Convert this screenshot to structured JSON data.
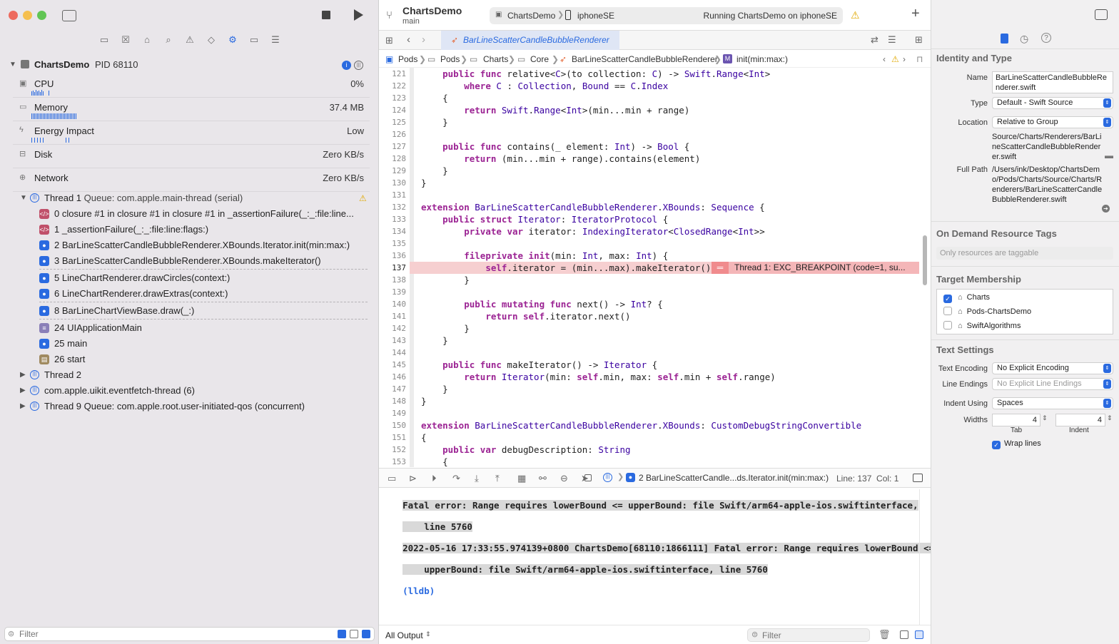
{
  "toolbar": {
    "project": "ChartsDemo",
    "branch": "main",
    "scheme": "ChartsDemo",
    "device": "iphoneSE",
    "status": "Running ChartsDemo on iphoneSE"
  },
  "debug_nav": {
    "process_name": "ChartsDemo",
    "process_pid": "PID 68110",
    "gauges": [
      {
        "label": "CPU",
        "value": "0%"
      },
      {
        "label": "Memory",
        "value": "37.4 MB"
      },
      {
        "label": "Energy Impact",
        "value": "Low"
      },
      {
        "label": "Disk",
        "value": "Zero KB/s"
      },
      {
        "label": "Network",
        "value": "Zero KB/s"
      }
    ],
    "thread1": {
      "name": "Thread 1",
      "queue": "Queue: com.apple.main-thread (serial)"
    },
    "frames": [
      "0 closure #1 in closure #1 in closure #1 in _assertionFailure(_:_:file:line...",
      "1 _assertionFailure(_:_:file:line:flags:)",
      "2 BarLineScatterCandleBubbleRenderer.XBounds.Iterator.init(min:max:)",
      "3 BarLineScatterCandleBubbleRenderer.XBounds.makeIterator()",
      "5 LineChartRenderer.drawCircles(context:)",
      "6 LineChartRenderer.drawExtras(context:)",
      "8 BarLineChartViewBase.draw(_:)",
      "24 UIApplicationMain",
      "25 main",
      "26 start"
    ],
    "other_threads": [
      "Thread 2",
      "com.apple.uikit.eventfetch-thread (6)",
      "Thread 9 Queue: com.apple.root.user-initiated-qos (concurrent)"
    ],
    "filter_placeholder": "Filter"
  },
  "editor": {
    "tab_title": "BarLineScatterCandleBubbleRenderer",
    "breadcrumbs": [
      "Pods",
      "Pods",
      "Charts",
      "Core",
      "BarLineScatterCandleBubbleRenderer",
      "init(min:max:)"
    ],
    "error_banner": "Thread 1: EXC_BREAKPOINT (code=1, su...",
    "lines": [
      {
        "n": "121",
        "t": "    public func relative<C>(to collection: C) -> Swift.Range<Int>"
      },
      {
        "n": "122",
        "t": "        where C : Collection, Bound == C.Index"
      },
      {
        "n": "123",
        "t": "    {"
      },
      {
        "n": "124",
        "t": "        return Swift.Range<Int>(min...min + range)"
      },
      {
        "n": "125",
        "t": "    }"
      },
      {
        "n": "126",
        "t": ""
      },
      {
        "n": "127",
        "t": "    public func contains(_ element: Int) -> Bool {"
      },
      {
        "n": "128",
        "t": "        return (min...min + range).contains(element)"
      },
      {
        "n": "129",
        "t": "    }"
      },
      {
        "n": "130",
        "t": "}"
      },
      {
        "n": "131",
        "t": ""
      },
      {
        "n": "132",
        "t": "extension BarLineScatterCandleBubbleRenderer.XBounds: Sequence {"
      },
      {
        "n": "133",
        "t": "    public struct Iterator: IteratorProtocol {"
      },
      {
        "n": "134",
        "t": "        private var iterator: IndexingIterator<ClosedRange<Int>>"
      },
      {
        "n": "135",
        "t": ""
      },
      {
        "n": "136",
        "t": "        fileprivate init(min: Int, max: Int) {"
      },
      {
        "n": "137",
        "t": "            self.iterator = (min...max).makeIterator()"
      },
      {
        "n": "138",
        "t": "        }"
      },
      {
        "n": "139",
        "t": ""
      },
      {
        "n": "140",
        "t": "        public mutating func next() -> Int? {"
      },
      {
        "n": "141",
        "t": "            return self.iterator.next()"
      },
      {
        "n": "142",
        "t": "        }"
      },
      {
        "n": "143",
        "t": "    }"
      },
      {
        "n": "144",
        "t": ""
      },
      {
        "n": "145",
        "t": "    public func makeIterator() -> Iterator {"
      },
      {
        "n": "146",
        "t": "        return Iterator(min: self.min, max: self.min + self.range)"
      },
      {
        "n": "147",
        "t": "    }"
      },
      {
        "n": "148",
        "t": "}"
      },
      {
        "n": "149",
        "t": ""
      },
      {
        "n": "150",
        "t": "extension BarLineScatterCandleBubbleRenderer.XBounds: CustomDebugStringConvertible"
      },
      {
        "n": "151",
        "t": "{"
      },
      {
        "n": "152",
        "t": "    public var debugDescription: String"
      },
      {
        "n": "153",
        "t": "    {"
      }
    ]
  },
  "debug_bar": {
    "frame_label": "2 BarLineScatterCandle...ds.Iterator.init(min:max:)",
    "line_col": "Line: 137  Col: 1"
  },
  "console": {
    "output": [
      "Fatal error: Range requires lowerBound <= upperBound: file Swift/arm64-apple-ios.swiftinterface,",
      "    line 5760",
      "2022-05-16 17:33:55.974139+0800 ChartsDemo[68110:1866111] Fatal error: Range requires lowerBound <=",
      "    upperBound: file Swift/arm64-apple-ios.swiftinterface, line 5760"
    ],
    "prompt": "(lldb)",
    "scope": "All Output",
    "filter_placeholder": "Filter"
  },
  "inspector": {
    "identity_title": "Identity and Type",
    "name_label": "Name",
    "name_value": "BarLineScatterCandleBubbleRenderer.swift",
    "type_label": "Type",
    "type_value": "Default - Swift Source",
    "location_label": "Location",
    "location_value": "Relative to Group",
    "location_path": "Source/Charts/Renderers/BarLineScatterCandleBubbleRenderer.swift",
    "fullpath_label": "Full Path",
    "fullpath_value": "/Users/ink/Desktop/ChartsDemo/Pods/Charts/Source/Charts/Renderers/BarLineScatterCandleBubbleRenderer.swift",
    "odr_title": "On Demand Resource Tags",
    "odr_placeholder": "Only resources are taggable",
    "target_title": "Target Membership",
    "targets": [
      {
        "name": "Charts",
        "checked": true
      },
      {
        "name": "Pods-ChartsDemo",
        "checked": false
      },
      {
        "name": "SwiftAlgorithms",
        "checked": false
      }
    ],
    "text_title": "Text Settings",
    "encoding_label": "Text Encoding",
    "encoding_value": "No Explicit Encoding",
    "endings_label": "Line Endings",
    "endings_value": "No Explicit Line Endings",
    "indent_label": "Indent Using",
    "indent_value": "Spaces",
    "widths_label": "Widths",
    "tab_value": "4",
    "indent_width_value": "4",
    "tab_label": "Tab",
    "indent_label2": "Indent",
    "wrap_label": "Wrap lines"
  }
}
